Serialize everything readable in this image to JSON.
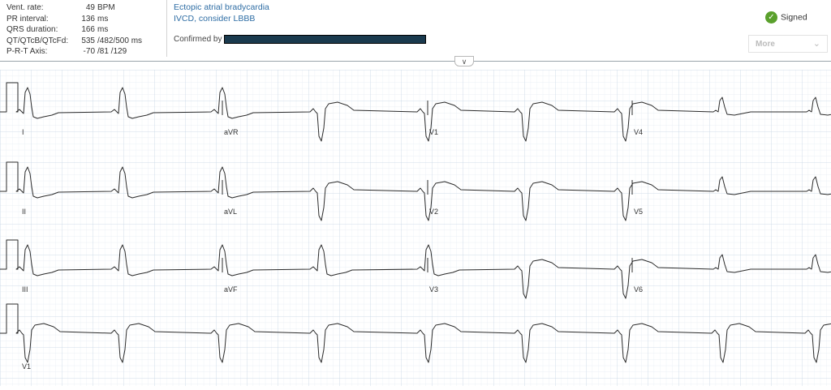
{
  "measurements": [
    {
      "label": "Vent. rate:",
      "value": "49",
      "unit": "BPM"
    },
    {
      "label": "PR interval:",
      "value": "136",
      "unit": "ms"
    },
    {
      "label": "QRS duration:",
      "value": "166",
      "unit": "ms"
    },
    {
      "label": "QT/QTcB/QTcFd:",
      "value": "535",
      "unit": "/482/500 ms"
    },
    {
      "label": "P-R-T Axis:",
      "value": "-70",
      "unit": "/81 /129"
    }
  ],
  "interpretation": [
    "Ectopic atrial bradycardia",
    "IVCD, consider LBBB"
  ],
  "confirmed_label": "Confirmed by",
  "status": {
    "label": "Signed",
    "icon": "check-circle-icon",
    "color": "#5aa02c"
  },
  "more_button": {
    "label": "More",
    "icon": "chevron-down-icon"
  },
  "collapse_toggle": {
    "icon": "chevron-down-icon"
  },
  "colors": {
    "grid_minor": "#e3eaf2",
    "grid_major": "#c8d6e6",
    "trace": "#2b2b2b",
    "link": "#2e6da4"
  },
  "ecg": {
    "rows": [
      [
        "I",
        "aVR",
        "V1",
        "V4"
      ],
      [
        "II",
        "aVL",
        "V2",
        "V5"
      ],
      [
        "III",
        "aVF",
        "V3",
        "V6"
      ],
      [
        "V1"
      ]
    ]
  }
}
